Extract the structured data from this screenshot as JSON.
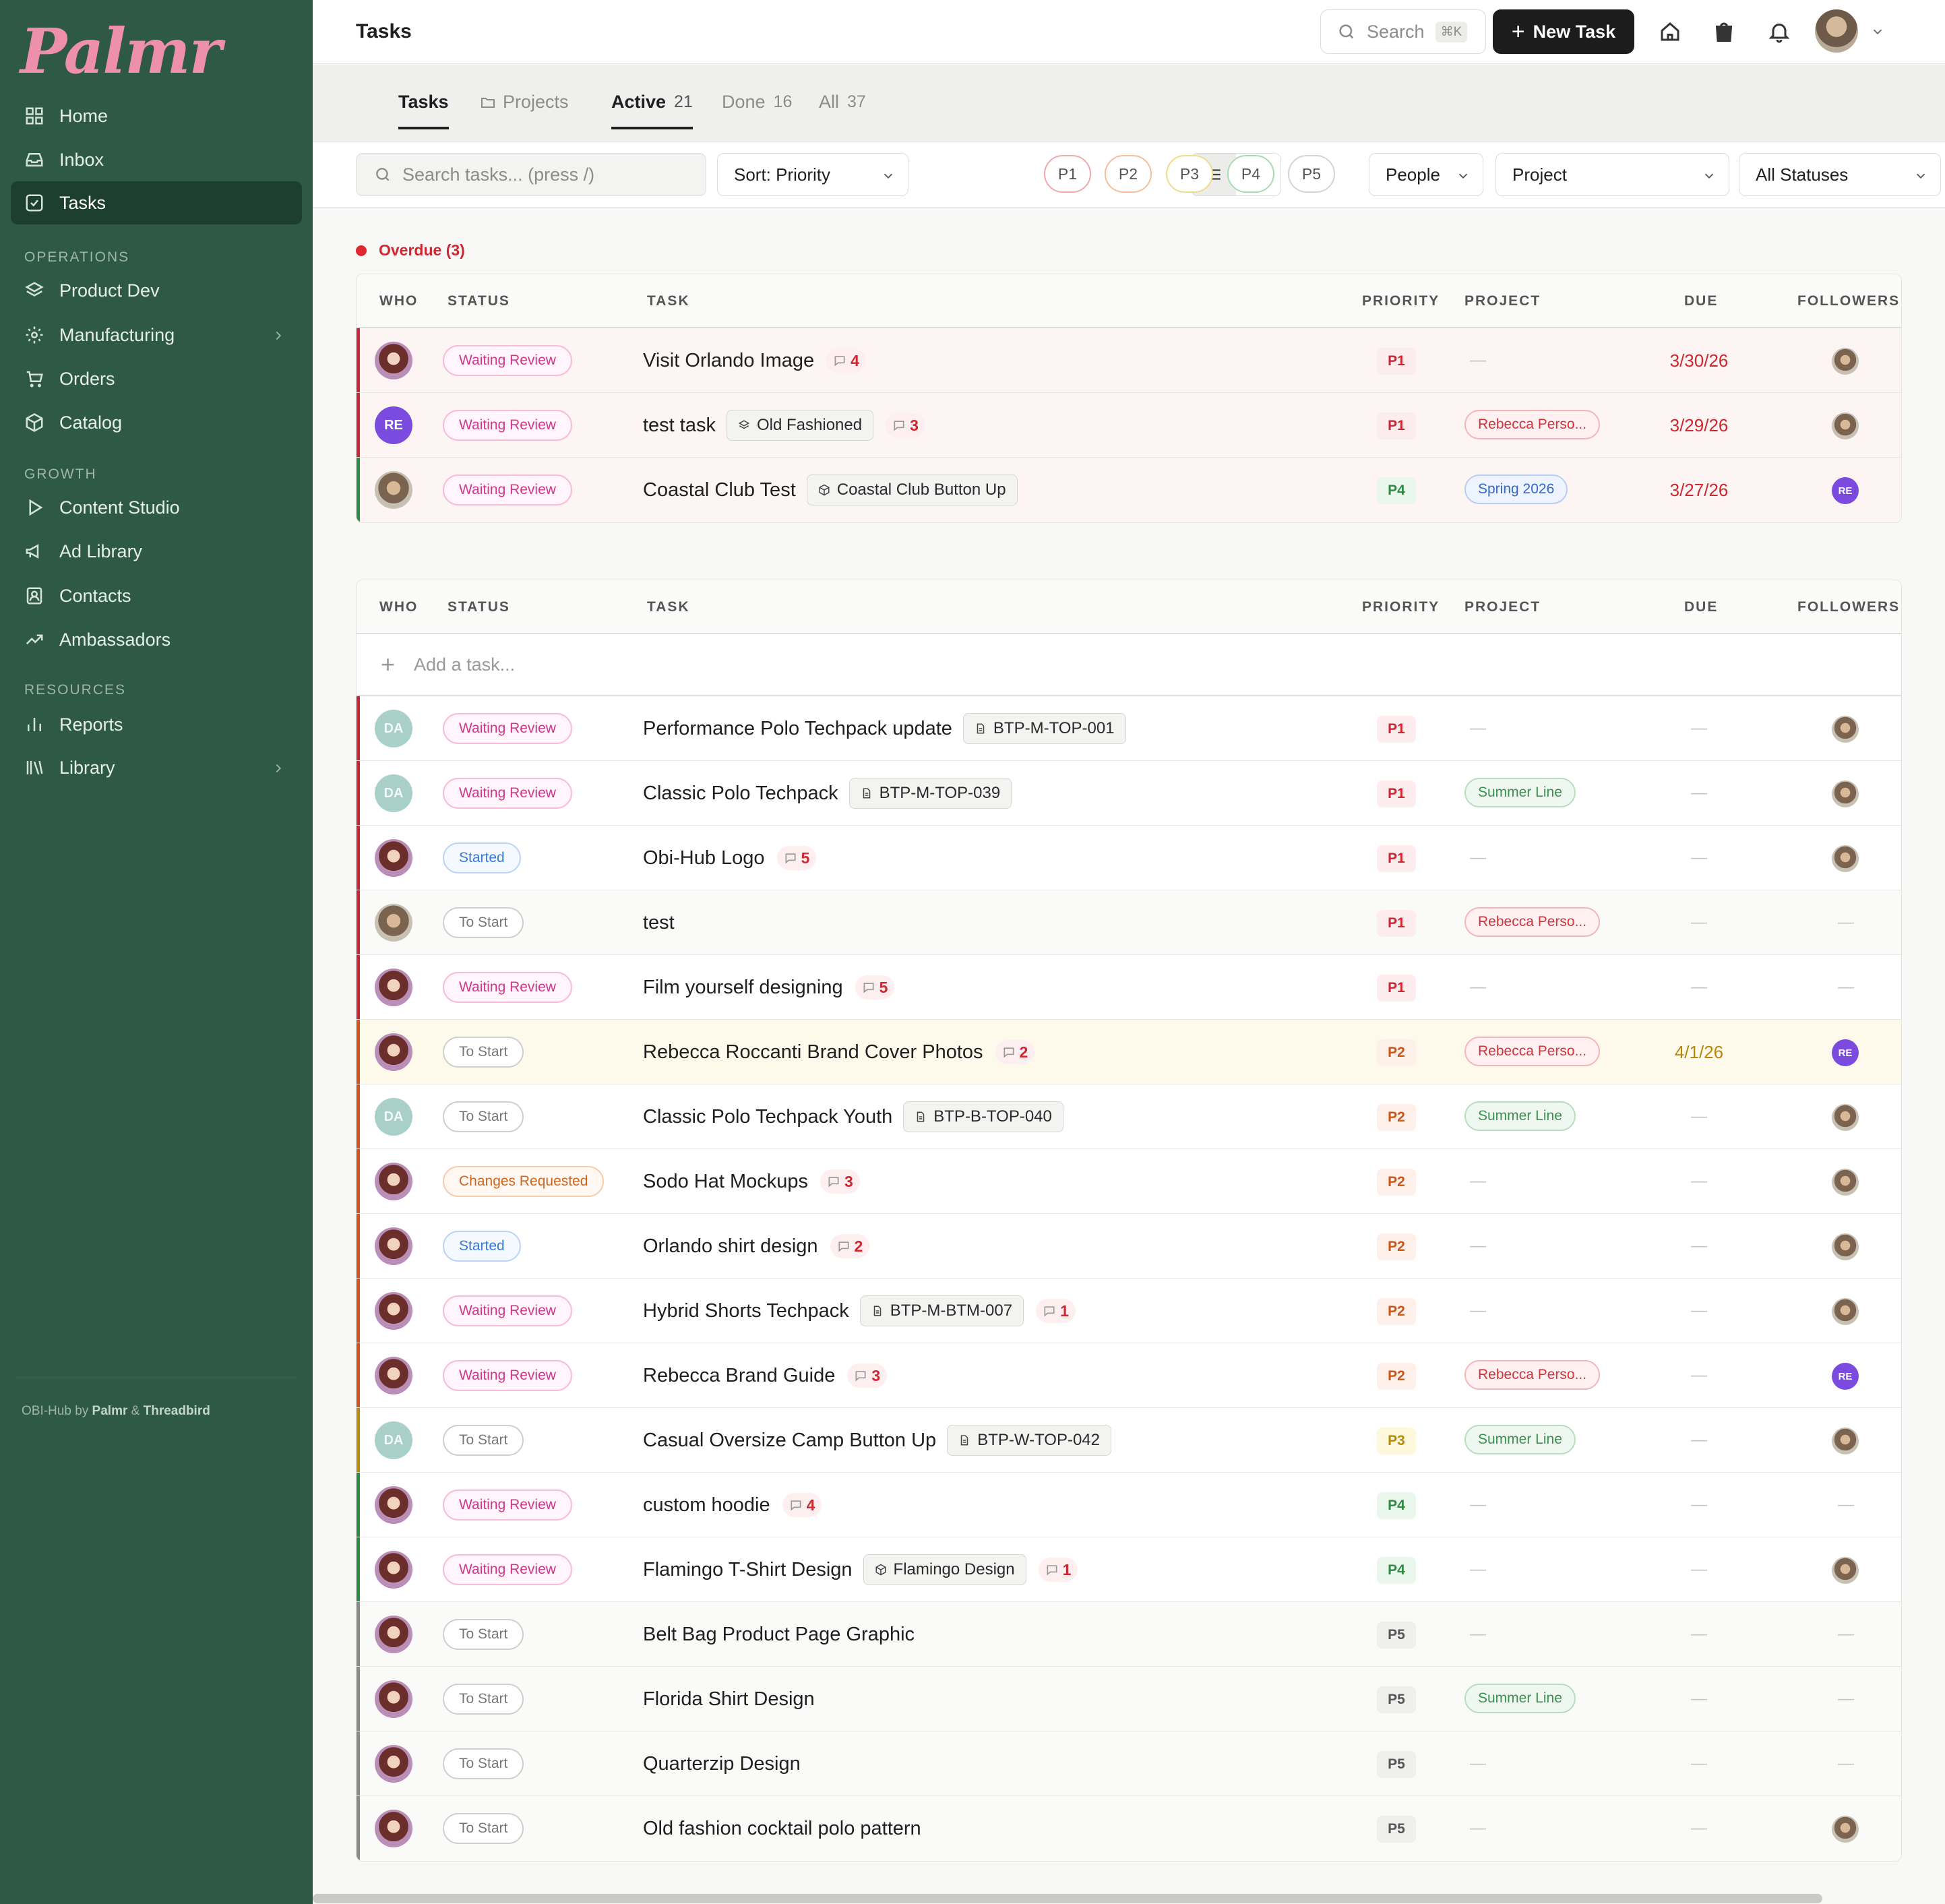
{
  "app": {
    "logo": "Palmr",
    "footer_prefix": "OBI-Hub by",
    "footer_brand1": "Palmr",
    "footer_amp": "&",
    "footer_brand2": "Threadbird"
  },
  "sidebar": {
    "items_top": [
      {
        "label": "Home",
        "icon": "grid-icon"
      },
      {
        "label": "Inbox",
        "icon": "inbox-icon"
      },
      {
        "label": "Tasks",
        "icon": "checkbox-icon",
        "active": true
      }
    ],
    "sections": [
      {
        "title": "OPERATIONS",
        "items": [
          {
            "label": "Product Dev",
            "icon": "layers-icon"
          },
          {
            "label": "Manufacturing",
            "icon": "gear-icon",
            "expandable": true
          },
          {
            "label": "Orders",
            "icon": "cart-icon"
          },
          {
            "label": "Catalog",
            "icon": "box-icon"
          }
        ]
      },
      {
        "title": "GROWTH",
        "items": [
          {
            "label": "Content Studio",
            "icon": "play-icon"
          },
          {
            "label": "Ad Library",
            "icon": "megaphone-icon"
          },
          {
            "label": "Contacts",
            "icon": "contact-icon"
          },
          {
            "label": "Ambassadors",
            "icon": "trend-icon"
          }
        ]
      },
      {
        "title": "RESOURCES",
        "items": [
          {
            "label": "Reports",
            "icon": "bar-chart-icon"
          },
          {
            "label": "Library",
            "icon": "books-icon",
            "expandable": true
          }
        ]
      }
    ]
  },
  "topbar": {
    "title": "Tasks",
    "search_label": "Search",
    "search_kbd": "⌘K",
    "new_task_label": "New Task"
  },
  "subtabs": {
    "tasks": "Tasks",
    "projects": "Projects",
    "active": "Active",
    "active_count": "21",
    "done": "Done",
    "done_count": "16",
    "all": "All",
    "all_count": "37"
  },
  "filters": {
    "search_placeholder": "Search tasks... (press /)",
    "sort": "Sort: Priority",
    "priorities": [
      "P1",
      "P2",
      "P3",
      "P4",
      "P5"
    ],
    "priority_colors": [
      "#f0a9ae",
      "#f4bf98",
      "#f0dc8a",
      "#a9dbb3",
      "#d4d4d2"
    ],
    "people": "People",
    "project": "Project",
    "statuses": "All Statuses"
  },
  "columns": {
    "who": "WHO",
    "status": "STATUS",
    "task": "TASK",
    "priority": "PRIORITY",
    "project": "PROJECT",
    "due": "DUE",
    "followers": "FOLLOWERS"
  },
  "overdue": {
    "label": "Overdue (3)",
    "rows": [
      {
        "who": "photo-b",
        "status": "Waiting Review",
        "status_kind": "wr",
        "task": "Visit Orlando Image",
        "comments": "4",
        "priority": "P1",
        "project": "—",
        "due": "3/30/26",
        "due_kind": "red",
        "follower": "photo-m"
      },
      {
        "who": "RE",
        "status": "Waiting Review",
        "status_kind": "wr",
        "task": "test task",
        "chip": "Old Fashioned",
        "chip_icon": "layers-icon",
        "comments": "3",
        "priority": "P1",
        "project": "Rebecca Perso...",
        "project_kind": "red",
        "due": "3/29/26",
        "due_kind": "red",
        "follower": "photo-m"
      },
      {
        "who": "photo-m",
        "status": "Waiting Review",
        "status_kind": "wr",
        "task": "Coastal Club Test",
        "chip": "Coastal Club Button Up",
        "chip_icon": "box-icon",
        "priority": "P4",
        "project": "Spring 2026",
        "project_kind": "blue",
        "due": "3/27/26",
        "due_kind": "red",
        "follower": "RE"
      }
    ]
  },
  "main": {
    "add_placeholder": "Add a task...",
    "rows": [
      {
        "who": "DA",
        "status": "Waiting Review",
        "status_kind": "wr",
        "task": "Performance Polo Techpack update",
        "chip": "BTP-M-TOP-001",
        "chip_icon": "doc-icon",
        "priority": "P1",
        "project": "—",
        "due": "—",
        "follower": "photo-m"
      },
      {
        "who": "DA",
        "status": "Waiting Review",
        "status_kind": "wr",
        "task": "Classic Polo Techpack",
        "chip": "BTP-M-TOP-039",
        "chip_icon": "doc-icon",
        "priority": "P1",
        "project": "Summer Line",
        "project_kind": "green",
        "due": "—",
        "follower": "photo-m"
      },
      {
        "who": "photo-b",
        "status": "Started",
        "status_kind": "st",
        "task": "Obi-Hub Logo",
        "comments": "5",
        "priority": "P1",
        "project": "—",
        "due": "—",
        "follower": "photo-m"
      },
      {
        "who": "photo-m",
        "status": "To Start",
        "status_kind": "ts",
        "task": "test",
        "priority": "P1",
        "project": "Rebecca Perso...",
        "project_kind": "red",
        "due": "—",
        "follower": "—"
      },
      {
        "who": "photo-b",
        "status": "Waiting Review",
        "status_kind": "wr",
        "task": "Film yourself designing",
        "comments": "5",
        "priority": "P1",
        "project": "—",
        "due": "—",
        "follower": "—"
      },
      {
        "who": "photo-b",
        "status": "To Start",
        "status_kind": "ts",
        "task": "Rebecca Roccanti Brand Cover Photos",
        "comments": "2",
        "priority": "P2",
        "project": "Rebecca Perso...",
        "project_kind": "red",
        "due": "4/1/26",
        "due_kind": "amber",
        "follower": "RE",
        "highlight": true
      },
      {
        "who": "DA",
        "status": "To Start",
        "status_kind": "ts",
        "task": "Classic Polo Techpack Youth",
        "chip": "BTP-B-TOP-040",
        "chip_icon": "doc-icon",
        "priority": "P2",
        "project": "Summer Line",
        "project_kind": "green",
        "due": "—",
        "follower": "photo-m"
      },
      {
        "who": "photo-b",
        "status": "Changes Requested",
        "status_kind": "cr",
        "task": "Sodo Hat Mockups",
        "comments": "3",
        "priority": "P2",
        "project": "—",
        "due": "—",
        "follower": "photo-m"
      },
      {
        "who": "photo-b",
        "status": "Started",
        "status_kind": "st",
        "task": "Orlando shirt design",
        "comments": "2",
        "priority": "P2",
        "project": "—",
        "due": "—",
        "follower": "photo-m"
      },
      {
        "who": "photo-b",
        "status": "Waiting Review",
        "status_kind": "wr",
        "task": "Hybrid Shorts Techpack",
        "chip": "BTP-M-BTM-007",
        "chip_icon": "doc-icon",
        "comments": "1",
        "priority": "P2",
        "project": "—",
        "due": "—",
        "follower": "photo-m"
      },
      {
        "who": "photo-b",
        "status": "Waiting Review",
        "status_kind": "wr",
        "task": "Rebecca Brand Guide",
        "comments": "3",
        "priority": "P2",
        "project": "Rebecca Perso...",
        "project_kind": "red",
        "due": "—",
        "follower": "RE"
      },
      {
        "who": "DA",
        "status": "To Start",
        "status_kind": "ts",
        "task": "Casual Oversize Camp Button Up",
        "chip": "BTP-W-TOP-042",
        "chip_icon": "doc-icon",
        "priority": "P3",
        "project": "Summer Line",
        "project_kind": "green",
        "due": "—",
        "follower": "photo-m"
      },
      {
        "who": "photo-b",
        "status": "Waiting Review",
        "status_kind": "wr",
        "task": "custom hoodie",
        "comments": "4",
        "priority": "P4",
        "project": "—",
        "due": "—",
        "follower": "—"
      },
      {
        "who": "photo-b",
        "status": "Waiting Review",
        "status_kind": "wr",
        "task": "Flamingo T-Shirt Design",
        "chip": "Flamingo Design",
        "chip_icon": "box-icon",
        "comments": "1",
        "priority": "P4",
        "project": "—",
        "due": "—",
        "follower": "photo-m"
      },
      {
        "who": "photo-b",
        "status": "To Start",
        "status_kind": "ts",
        "task": "Belt Bag Product Page Graphic",
        "priority": "P5",
        "project": "—",
        "due": "—",
        "follower": "—"
      },
      {
        "who": "photo-b",
        "status": "To Start",
        "status_kind": "ts",
        "task": "Florida Shirt Design",
        "priority": "P5",
        "project": "Summer Line",
        "project_kind": "green",
        "due": "—",
        "follower": "—"
      },
      {
        "who": "photo-b",
        "status": "To Start",
        "status_kind": "ts",
        "task": "Quarterzip Design",
        "priority": "P5",
        "project": "—",
        "due": "—",
        "follower": "—"
      },
      {
        "who": "photo-b",
        "status": "To Start",
        "status_kind": "ts",
        "task": "Old fashion cocktail polo pattern",
        "priority": "P5",
        "project": "—",
        "due": "—",
        "follower": "photo-m"
      }
    ]
  },
  "priority_bar_colors": {
    "P1": "#c62835",
    "P2": "#d2561c",
    "P3": "#b88a10",
    "P4": "#2f8a43",
    "P5": "#8a8a88"
  }
}
